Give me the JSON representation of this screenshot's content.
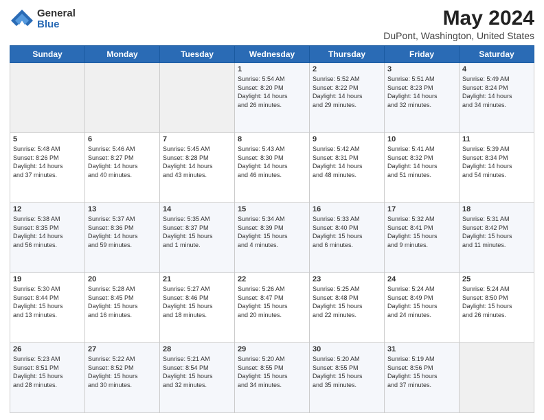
{
  "header": {
    "logo_general": "General",
    "logo_blue": "Blue",
    "title": "May 2024",
    "subtitle": "DuPont, Washington, United States"
  },
  "days_of_week": [
    "Sunday",
    "Monday",
    "Tuesday",
    "Wednesday",
    "Thursday",
    "Friday",
    "Saturday"
  ],
  "weeks": [
    [
      {
        "day": "",
        "info": ""
      },
      {
        "day": "",
        "info": ""
      },
      {
        "day": "",
        "info": ""
      },
      {
        "day": "1",
        "info": "Sunrise: 5:54 AM\nSunset: 8:20 PM\nDaylight: 14 hours\nand 26 minutes."
      },
      {
        "day": "2",
        "info": "Sunrise: 5:52 AM\nSunset: 8:22 PM\nDaylight: 14 hours\nand 29 minutes."
      },
      {
        "day": "3",
        "info": "Sunrise: 5:51 AM\nSunset: 8:23 PM\nDaylight: 14 hours\nand 32 minutes."
      },
      {
        "day": "4",
        "info": "Sunrise: 5:49 AM\nSunset: 8:24 PM\nDaylight: 14 hours\nand 34 minutes."
      }
    ],
    [
      {
        "day": "5",
        "info": "Sunrise: 5:48 AM\nSunset: 8:26 PM\nDaylight: 14 hours\nand 37 minutes."
      },
      {
        "day": "6",
        "info": "Sunrise: 5:46 AM\nSunset: 8:27 PM\nDaylight: 14 hours\nand 40 minutes."
      },
      {
        "day": "7",
        "info": "Sunrise: 5:45 AM\nSunset: 8:28 PM\nDaylight: 14 hours\nand 43 minutes."
      },
      {
        "day": "8",
        "info": "Sunrise: 5:43 AM\nSunset: 8:30 PM\nDaylight: 14 hours\nand 46 minutes."
      },
      {
        "day": "9",
        "info": "Sunrise: 5:42 AM\nSunset: 8:31 PM\nDaylight: 14 hours\nand 48 minutes."
      },
      {
        "day": "10",
        "info": "Sunrise: 5:41 AM\nSunset: 8:32 PM\nDaylight: 14 hours\nand 51 minutes."
      },
      {
        "day": "11",
        "info": "Sunrise: 5:39 AM\nSunset: 8:34 PM\nDaylight: 14 hours\nand 54 minutes."
      }
    ],
    [
      {
        "day": "12",
        "info": "Sunrise: 5:38 AM\nSunset: 8:35 PM\nDaylight: 14 hours\nand 56 minutes."
      },
      {
        "day": "13",
        "info": "Sunrise: 5:37 AM\nSunset: 8:36 PM\nDaylight: 14 hours\nand 59 minutes."
      },
      {
        "day": "14",
        "info": "Sunrise: 5:35 AM\nSunset: 8:37 PM\nDaylight: 15 hours\nand 1 minute."
      },
      {
        "day": "15",
        "info": "Sunrise: 5:34 AM\nSunset: 8:39 PM\nDaylight: 15 hours\nand 4 minutes."
      },
      {
        "day": "16",
        "info": "Sunrise: 5:33 AM\nSunset: 8:40 PM\nDaylight: 15 hours\nand 6 minutes."
      },
      {
        "day": "17",
        "info": "Sunrise: 5:32 AM\nSunset: 8:41 PM\nDaylight: 15 hours\nand 9 minutes."
      },
      {
        "day": "18",
        "info": "Sunrise: 5:31 AM\nSunset: 8:42 PM\nDaylight: 15 hours\nand 11 minutes."
      }
    ],
    [
      {
        "day": "19",
        "info": "Sunrise: 5:30 AM\nSunset: 8:44 PM\nDaylight: 15 hours\nand 13 minutes."
      },
      {
        "day": "20",
        "info": "Sunrise: 5:28 AM\nSunset: 8:45 PM\nDaylight: 15 hours\nand 16 minutes."
      },
      {
        "day": "21",
        "info": "Sunrise: 5:27 AM\nSunset: 8:46 PM\nDaylight: 15 hours\nand 18 minutes."
      },
      {
        "day": "22",
        "info": "Sunrise: 5:26 AM\nSunset: 8:47 PM\nDaylight: 15 hours\nand 20 minutes."
      },
      {
        "day": "23",
        "info": "Sunrise: 5:25 AM\nSunset: 8:48 PM\nDaylight: 15 hours\nand 22 minutes."
      },
      {
        "day": "24",
        "info": "Sunrise: 5:24 AM\nSunset: 8:49 PM\nDaylight: 15 hours\nand 24 minutes."
      },
      {
        "day": "25",
        "info": "Sunrise: 5:24 AM\nSunset: 8:50 PM\nDaylight: 15 hours\nand 26 minutes."
      }
    ],
    [
      {
        "day": "26",
        "info": "Sunrise: 5:23 AM\nSunset: 8:51 PM\nDaylight: 15 hours\nand 28 minutes."
      },
      {
        "day": "27",
        "info": "Sunrise: 5:22 AM\nSunset: 8:52 PM\nDaylight: 15 hours\nand 30 minutes."
      },
      {
        "day": "28",
        "info": "Sunrise: 5:21 AM\nSunset: 8:54 PM\nDaylight: 15 hours\nand 32 minutes."
      },
      {
        "day": "29",
        "info": "Sunrise: 5:20 AM\nSunset: 8:55 PM\nDaylight: 15 hours\nand 34 minutes."
      },
      {
        "day": "30",
        "info": "Sunrise: 5:20 AM\nSunset: 8:55 PM\nDaylight: 15 hours\nand 35 minutes."
      },
      {
        "day": "31",
        "info": "Sunrise: 5:19 AM\nSunset: 8:56 PM\nDaylight: 15 hours\nand 37 minutes."
      },
      {
        "day": "",
        "info": ""
      }
    ]
  ],
  "colors": {
    "header_bg": "#2a6bb5",
    "header_text": "#ffffff",
    "odd_row_bg": "#f5f7fb",
    "even_row_bg": "#ffffff",
    "empty_bg": "#eeeeee"
  }
}
